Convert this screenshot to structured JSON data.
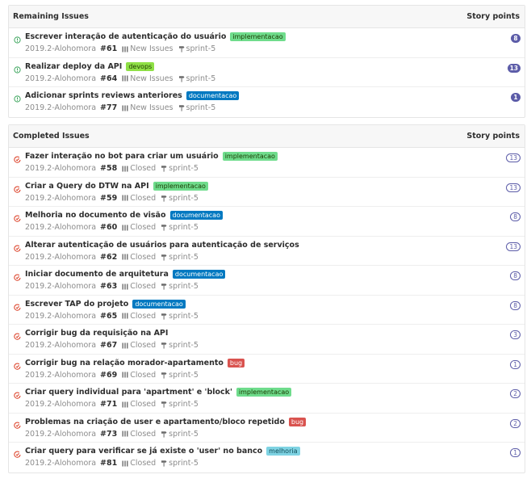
{
  "colors": {
    "open_icon": "#3ba55c",
    "closed_icon": "#db3b21",
    "points": "#5c5ca8",
    "label_implementacao_bg": "#69d100",
    "label_devops_bg": "#8fe046",
    "label_documentacao_bg": "#0079c1",
    "label_bug_bg": "#d9534f",
    "label_melhoria_bg": "#7fd3e3"
  },
  "remaining": {
    "header": "Remaining Issues",
    "points_header": "Story points",
    "issues": [
      {
        "title": "Escrever interação de autenticação do usuário",
        "label": "implementacao",
        "label_kind": "implementacao",
        "project": "2019.2-Alohomora",
        "number": "#61",
        "board": "New Issues",
        "milestone": "sprint-5",
        "points": "8"
      },
      {
        "title": "Realizar deploy da API",
        "label": "devops",
        "label_kind": "devops",
        "project": "2019.2-Alohomora",
        "number": "#64",
        "board": "New Issues",
        "milestone": "sprint-5",
        "points": "13"
      },
      {
        "title": "Adicionar sprints reviews anteriores",
        "label": "documentacao",
        "label_kind": "documentacao",
        "project": "2019.2-Alohomora",
        "number": "#77",
        "board": "New Issues",
        "milestone": "sprint-5",
        "points": "1"
      }
    ]
  },
  "completed": {
    "header": "Completed Issues",
    "points_header": "Story points",
    "issues": [
      {
        "title": "Fazer interação no bot para criar um usuário",
        "label": "implementacao",
        "label_kind": "implementacao",
        "project": "2019.2-Alohomora",
        "number": "#58",
        "board": "Closed",
        "milestone": "sprint-5",
        "points": "13"
      },
      {
        "title": "Criar a Query do DTW na API",
        "label": "implementacao",
        "label_kind": "implementacao",
        "project": "2019.2-Alohomora",
        "number": "#59",
        "board": "Closed",
        "milestone": "sprint-5",
        "points": "13"
      },
      {
        "title": "Melhoria no documento de visão",
        "label": "documentacao",
        "label_kind": "documentacao",
        "project": "2019.2-Alohomora",
        "number": "#60",
        "board": "Closed",
        "milestone": "sprint-5",
        "points": "8"
      },
      {
        "title": "Alterar autenticação de usuários para autenticação de serviços",
        "label": "",
        "label_kind": "",
        "project": "2019.2-Alohomora",
        "number": "#62",
        "board": "Closed",
        "milestone": "sprint-5",
        "points": "13"
      },
      {
        "title": "Iniciar documento de arquitetura",
        "label": "documentacao",
        "label_kind": "documentacao",
        "project": "2019.2-Alohomora",
        "number": "#63",
        "board": "Closed",
        "milestone": "sprint-5",
        "points": "8"
      },
      {
        "title": "Escrever TAP do projeto",
        "label": "documentacao",
        "label_kind": "documentacao",
        "project": "2019.2-Alohomora",
        "number": "#65",
        "board": "Closed",
        "milestone": "sprint-5",
        "points": "8"
      },
      {
        "title": "Corrigir bug da requisição na API",
        "label": "",
        "label_kind": "",
        "project": "2019.2-Alohomora",
        "number": "#67",
        "board": "Closed",
        "milestone": "sprint-5",
        "points": "3"
      },
      {
        "title": "Corrigir bug na relação morador-apartamento",
        "label": "bug",
        "label_kind": "bug",
        "project": "2019.2-Alohomora",
        "number": "#69",
        "board": "Closed",
        "milestone": "sprint-5",
        "points": "1"
      },
      {
        "title": "Criar query individual para 'apartment' e 'block'",
        "label": "implementacao",
        "label_kind": "implementacao",
        "project": "2019.2-Alohomora",
        "number": "#71",
        "board": "Closed",
        "milestone": "sprint-5",
        "points": "2"
      },
      {
        "title": "Problemas na criação de user e apartamento/bloco repetido",
        "label": "bug",
        "label_kind": "bug",
        "project": "2019.2-Alohomora",
        "number": "#73",
        "board": "Closed",
        "milestone": "sprint-5",
        "points": "2"
      },
      {
        "title": "Criar query para verificar se já existe o 'user' no banco",
        "label": "melhoria",
        "label_kind": "melhoria",
        "project": "2019.2-Alohomora",
        "number": "#81",
        "board": "Closed",
        "milestone": "sprint-5",
        "points": "1"
      }
    ]
  }
}
